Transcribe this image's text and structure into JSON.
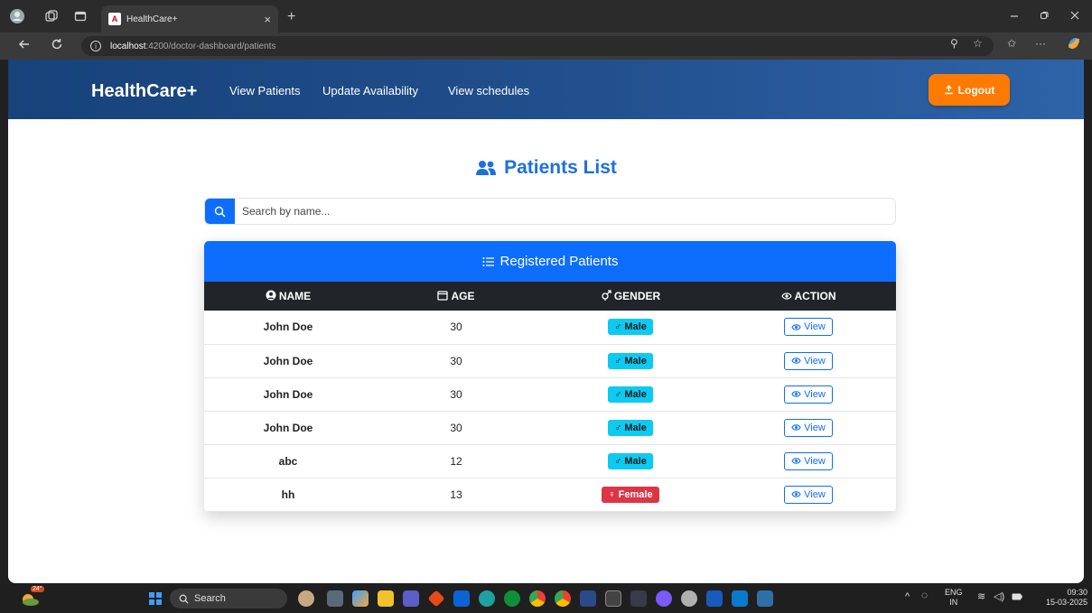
{
  "browser": {
    "tab_title": "HealthCare+",
    "tab_favicon": "A",
    "tab_close": "×",
    "new_tab": "+",
    "url_host": "localhost",
    "url_path": ":4200/doctor-dashboard/patients"
  },
  "header": {
    "brand": "HealthCare+",
    "nav": [
      "View Patients",
      "Update Availability",
      "View schedules"
    ],
    "logout_label": "Logout",
    "accent_color": "#ff7a00"
  },
  "main": {
    "title": "Patients List",
    "search_placeholder": "Search by name...",
    "card_title": "Registered Patients",
    "columns": [
      "NAME",
      "AGE",
      "GENDER",
      "ACTION"
    ],
    "rows": [
      {
        "name": "John Doe",
        "age": "30",
        "gender": "Male",
        "action": "View"
      },
      {
        "name": "John Doe",
        "age": "30",
        "gender": "Male",
        "action": "View"
      },
      {
        "name": "John Doe",
        "age": "30",
        "gender": "Male",
        "action": "View"
      },
      {
        "name": "John Doe",
        "age": "30",
        "gender": "Male",
        "action": "View"
      },
      {
        "name": "abc",
        "age": "12",
        "gender": "Male",
        "action": "View"
      },
      {
        "name": "hh",
        "age": "13",
        "gender": "Female",
        "action": "View"
      }
    ]
  },
  "taskbar": {
    "temperature": "24°",
    "search_label": "Search",
    "lang": "ENG",
    "region": "IN",
    "time": "09:30",
    "date": "15-03-2025"
  }
}
